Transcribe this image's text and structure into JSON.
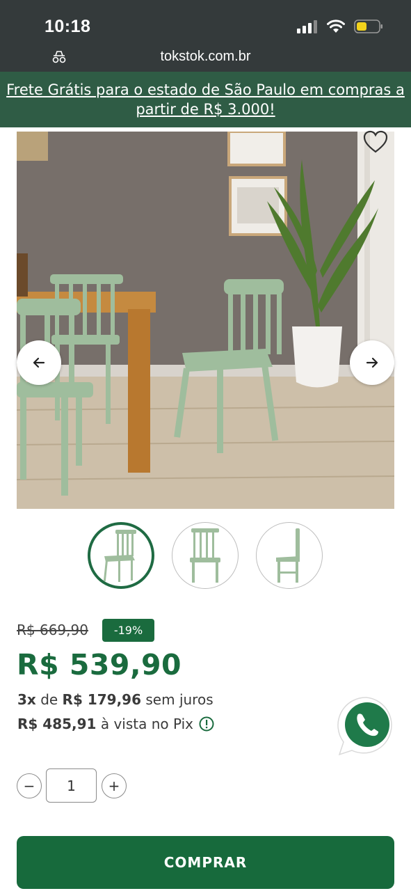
{
  "status_bar": {
    "time": "10:18",
    "icons": [
      "signal-icon",
      "wifi-icon",
      "battery-icon"
    ],
    "battery_color": "#f2d21b"
  },
  "browser": {
    "url": "tokstok.com.br",
    "site_icon": "site-settings-icon"
  },
  "promo": {
    "text": "Frete Grátis para o estado de São Paulo em compras a partir de R$ 3.000!",
    "background": "#2f5c45"
  },
  "gallery": {
    "prev_icon": "arrow-left-icon",
    "next_icon": "arrow-right-icon",
    "favorite_icon": "heart-icon",
    "thumbnails": [
      {
        "view": "three-quarter",
        "active": true
      },
      {
        "view": "front",
        "active": false
      },
      {
        "view": "side",
        "active": false
      }
    ]
  },
  "pricing": {
    "old_price": "R$ 669,90",
    "discount": "-19%",
    "price": "R$ 539,90",
    "installments_count": "3x",
    "installments_de": "de",
    "installments_value": "R$ 179,96",
    "installments_suffix": "sem juros",
    "pix_value": "R$ 485,91",
    "pix_suffix": "à vista no Pix",
    "accent": "#1a6b3e"
  },
  "quantity": {
    "minus": "−",
    "value": "1",
    "plus": "+"
  },
  "cta": {
    "buy_label": "COMPRAR"
  }
}
